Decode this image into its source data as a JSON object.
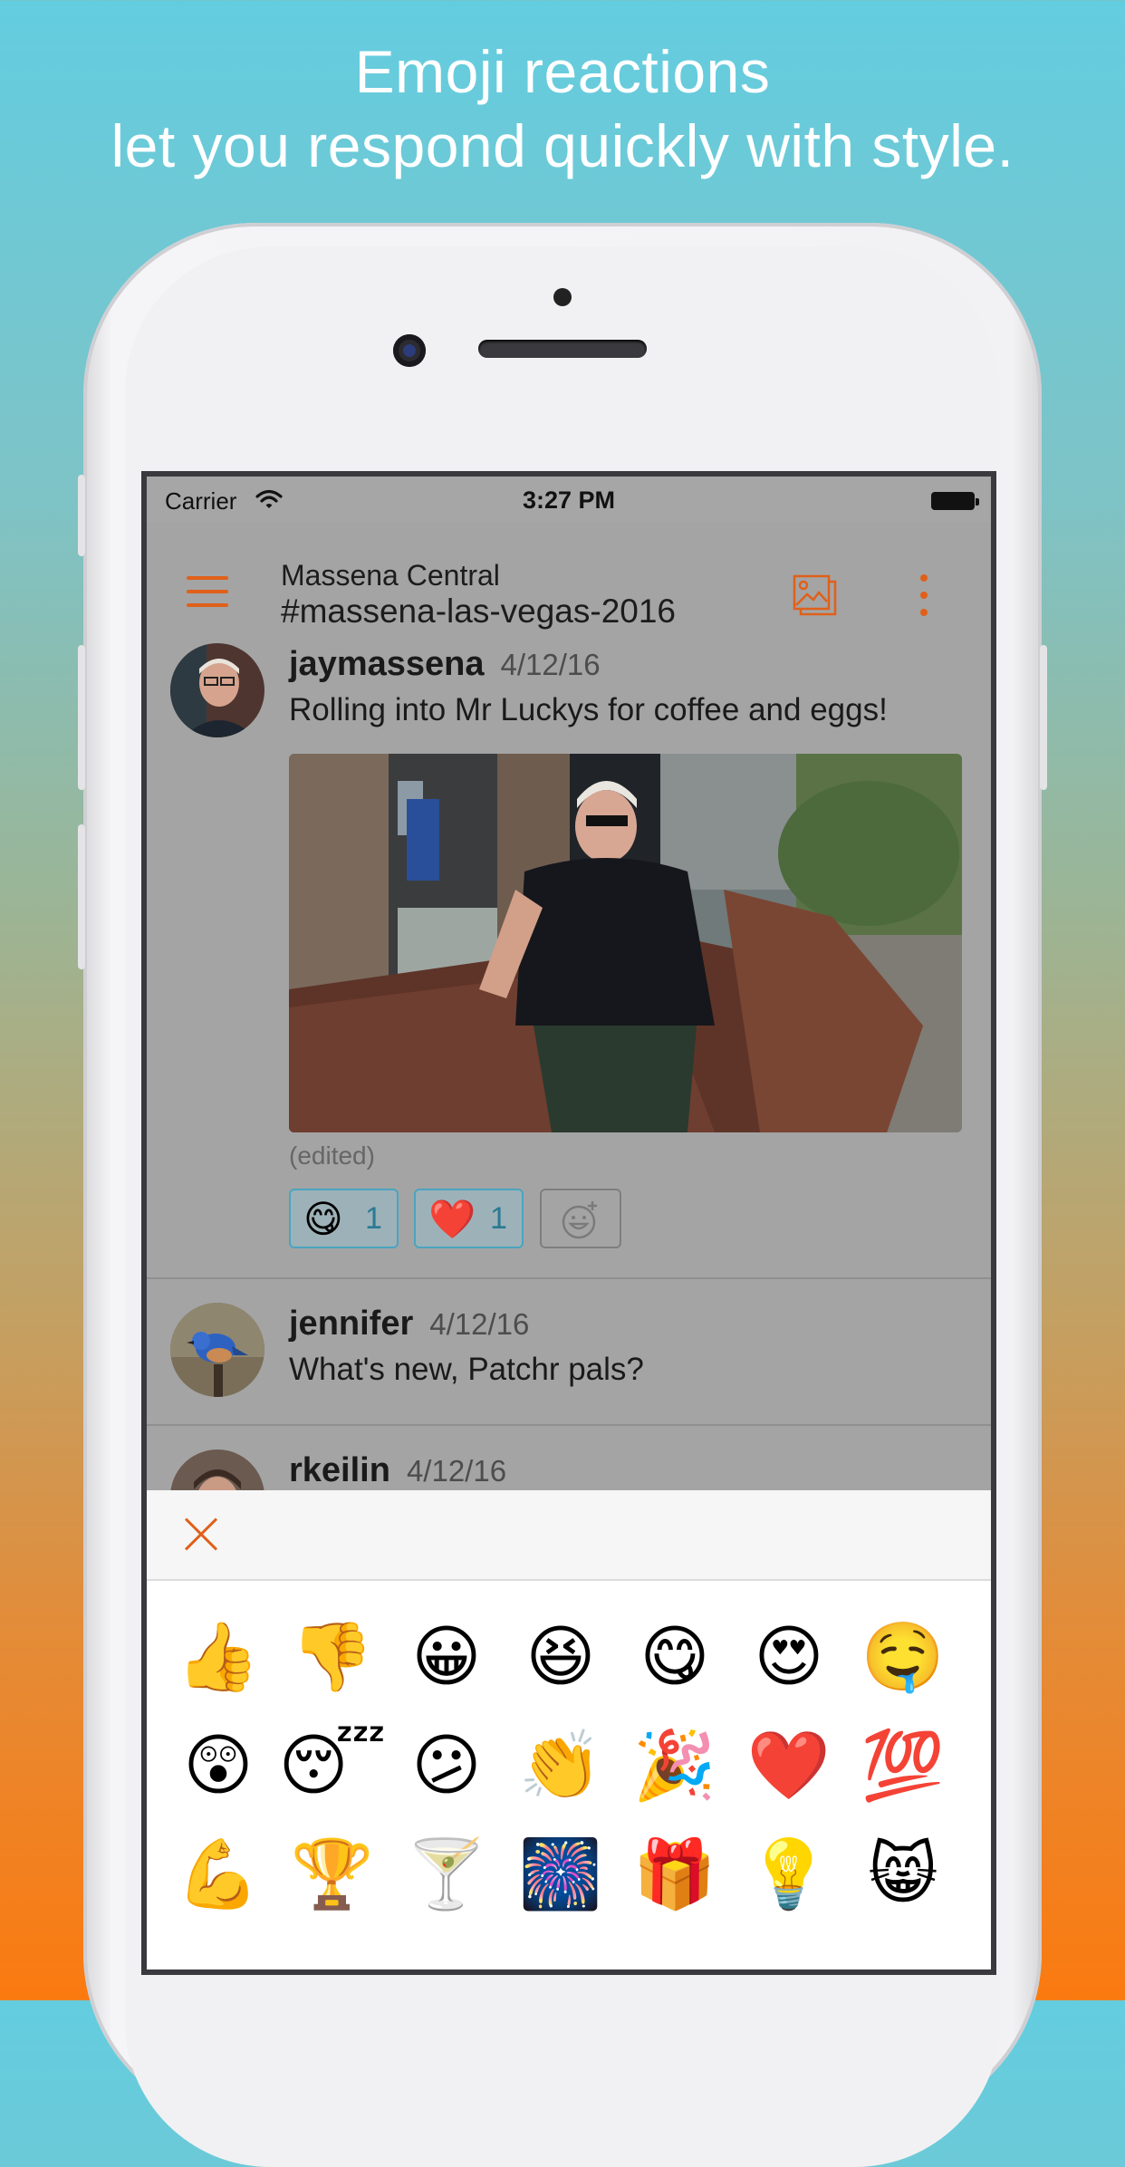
{
  "headline": {
    "line1": "Emoji reactions",
    "line2": "let you respond quickly with style."
  },
  "status_bar": {
    "carrier": "Carrier",
    "time": "3:27 PM"
  },
  "nav": {
    "group": "Massena Central",
    "channel": "#massena-las-vegas-2016",
    "menu_icon": "hamburger-menu-icon",
    "photos_icon": "photo-gallery-icon",
    "more_icon": "more-vertical-icon",
    "accent_color": "#e0601a"
  },
  "messages": [
    {
      "user": "jaymassena",
      "date": "4/12/16",
      "text": "Rolling into Mr Luckys for coffee and eggs!",
      "edited_label": "(edited)",
      "reactions": [
        {
          "emoji": "😋",
          "count": "1"
        },
        {
          "emoji": "❤️",
          "count": "1"
        }
      ],
      "add_reaction_icon": "add-emoji-icon"
    },
    {
      "user": "jennifer",
      "date": "4/12/16",
      "text": "What's new, Patchr pals?"
    },
    {
      "user": "rkeilin",
      "date": "4/12/16"
    }
  ],
  "picker": {
    "close_icon": "close-x-icon",
    "emojis": [
      "👍",
      "👎",
      "😀",
      "😆",
      "😋",
      "😍",
      "🤤",
      "😲",
      "😴",
      "😕",
      "👏",
      "🎉",
      "❤️",
      "💯",
      "💪",
      "🏆",
      "🍸",
      "🎆",
      "🎁",
      "💡",
      "😸"
    ]
  }
}
